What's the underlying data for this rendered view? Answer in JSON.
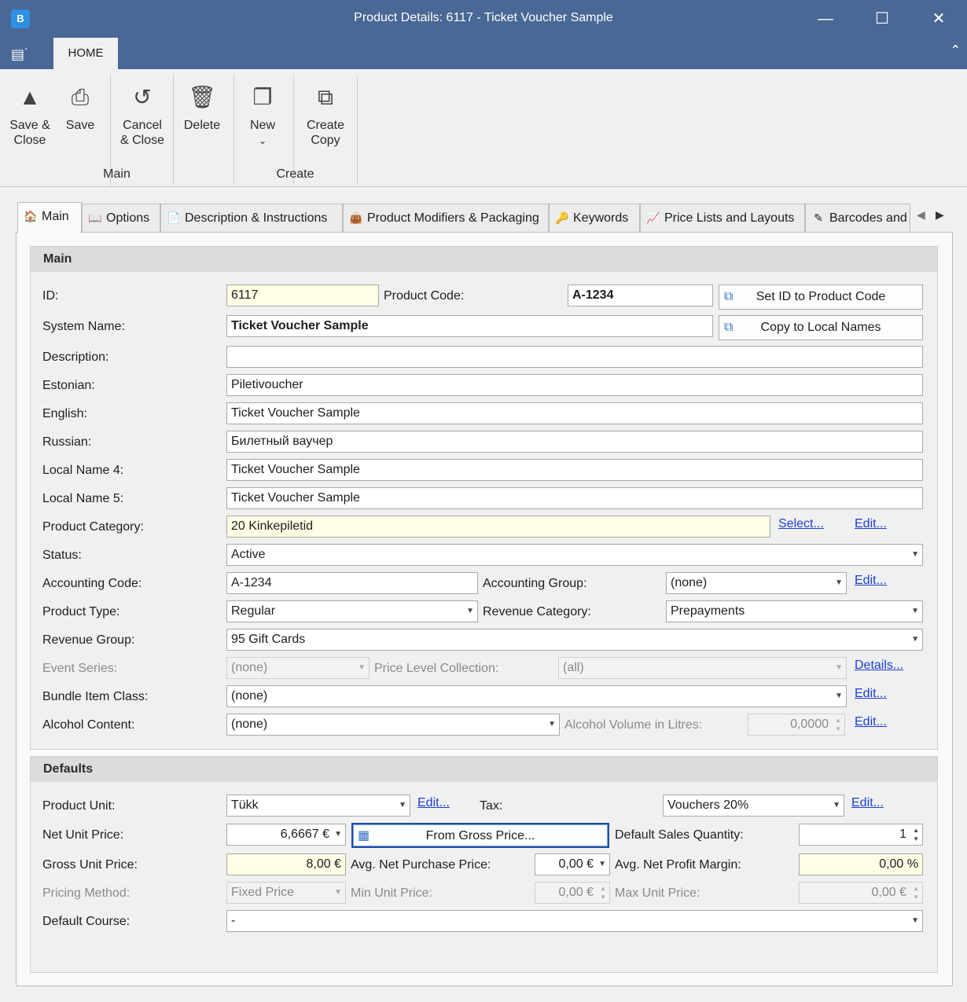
{
  "window": {
    "app_icon": "B",
    "title": "Product Details: 6117 - Ticket Voucher Sample",
    "minimize_icon": "minimize-icon",
    "maximize_icon": "maximize-icon",
    "close_icon": "close-icon"
  },
  "ribbon": {
    "home_tab": "HOME",
    "buttons": {
      "save_close": "Save &\nClose",
      "save": "Save",
      "cancel_close": "Cancel\n& Close",
      "delete": "Delete",
      "new": "New",
      "create_copy": "Create\nCopy"
    },
    "groups": {
      "main": "Main",
      "create": "Create"
    }
  },
  "tabs": [
    {
      "label": "Main",
      "icon": "house-icon"
    },
    {
      "label": "Options",
      "icon": "book-icon"
    },
    {
      "label": "Description & Instructions",
      "icon": "info-doc-icon"
    },
    {
      "label": "Product Modifiers & Packaging",
      "icon": "bag-icon"
    },
    {
      "label": "Keywords",
      "icon": "key-icon"
    },
    {
      "label": "Price Lists and Layouts",
      "icon": "price-list-icon"
    },
    {
      "label": "Barcodes and",
      "icon": "barcode-icon"
    }
  ],
  "main_group": {
    "title": "Main",
    "id_label": "ID:",
    "id_value": "6117",
    "product_code_label": "Product Code:",
    "product_code_value": "A-1234",
    "set_id_button": "Set ID to Product Code",
    "system_name_label": "System Name:",
    "system_name_value": "Ticket Voucher Sample",
    "copy_local_button": "Copy to Local Names",
    "description_label": "Description:",
    "description_value": "",
    "estonian_label": "Estonian:",
    "estonian_value": "Piletivoucher",
    "english_label": "English:",
    "english_value": "Ticket Voucher Sample",
    "russian_label": "Russian:",
    "russian_value": "Билетный ваучер",
    "local4_label": "Local Name 4:",
    "local4_value": "Ticket Voucher Sample",
    "local5_label": "Local Name 5:",
    "local5_value": "Ticket Voucher Sample",
    "category_label": "Product Category:",
    "category_value": "20 Kinkepiletid",
    "select_link": "Select...",
    "edit_link": "Edit...",
    "status_label": "Status:",
    "status_value": "Active",
    "acc_code_label": "Accounting Code:",
    "acc_code_value": "A-1234",
    "acc_group_label": "Accounting Group:",
    "acc_group_value": "(none)",
    "product_type_label": "Product Type:",
    "product_type_value": "Regular",
    "revenue_cat_label": "Revenue Category:",
    "revenue_cat_value": "Prepayments",
    "revenue_group_label": "Revenue Group:",
    "revenue_group_value": "95 Gift Cards",
    "event_series_label": "Event Series:",
    "event_series_value": "(none)",
    "price_level_label": "Price Level Collection:",
    "price_level_value": "(all)",
    "details_link": "Details...",
    "bundle_label": "Bundle Item Class:",
    "bundle_value": "(none)",
    "alcohol_label": "Alcohol Content:",
    "alcohol_value": "(none)",
    "alcohol_volume_label": "Alcohol Volume in Litres:",
    "alcohol_volume_value": "0,0000"
  },
  "defaults_group": {
    "title": "Defaults",
    "unit_label": "Product Unit:",
    "unit_value": "Tükk",
    "edit_link": "Edit...",
    "tax_label": "Tax:",
    "tax_value": "Vouchers 20%",
    "net_price_label": "Net Unit Price:",
    "net_price_value": "6,6667 €",
    "from_gross_button": "From Gross Price...",
    "sales_qty_label": "Default Sales Quantity:",
    "sales_qty_value": "1",
    "gross_price_label": "Gross Unit Price:",
    "gross_price_value": "8,00 €",
    "avg_purchase_label": "Avg. Net Purchase Price:",
    "avg_purchase_value": "0,00 €",
    "margin_label": "Avg. Net Profit Margin:",
    "margin_value": "0,00 %",
    "pricing_method_label": "Pricing Method:",
    "pricing_method_value": "Fixed Price",
    "min_price_label": "Min Unit Price:",
    "min_price_value": "0,00 €",
    "max_price_label": "Max Unit Price:",
    "max_price_value": "0,00 €",
    "course_label": "Default Course:",
    "course_value": "-"
  }
}
